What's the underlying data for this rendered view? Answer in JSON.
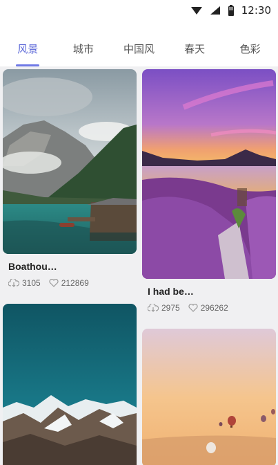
{
  "status_bar": {
    "time": "12:30"
  },
  "tabs": [
    {
      "label": "风景",
      "active": true
    },
    {
      "label": "城市",
      "active": false
    },
    {
      "label": "中国风",
      "active": false
    },
    {
      "label": "春天",
      "active": false
    },
    {
      "label": "色彩",
      "active": false
    }
  ],
  "theme": {
    "accent": "#5b67d8",
    "underline": "#6f79e6",
    "content_bg": "#f0f0f2"
  },
  "cards": [
    {
      "title": "Boathou…",
      "downloads": "3105",
      "likes": "212869"
    },
    {
      "title": "I had be…",
      "downloads": "2975",
      "likes": "296262"
    }
  ]
}
